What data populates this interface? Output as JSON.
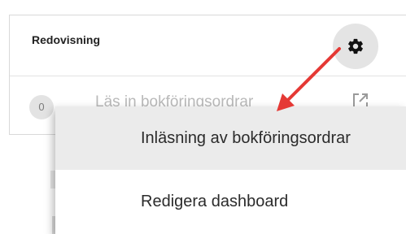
{
  "widget": {
    "title": "Redovisning",
    "settings_icon": "gear-icon",
    "rows": [
      {
        "count": "0",
        "label": "Läs in bokföringsordrar",
        "icon": "external-link-icon"
      }
    ]
  },
  "menu": {
    "items": [
      {
        "label": "Inläsning av bokföringsordrar",
        "highlighted": true
      },
      {
        "label": "Redigera dashboard",
        "highlighted": false
      }
    ]
  },
  "annotation": {
    "type": "arrow",
    "color": "#e53935"
  }
}
